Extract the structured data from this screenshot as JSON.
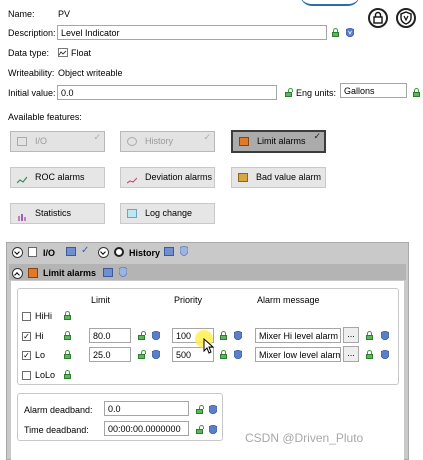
{
  "header": {
    "name_label": "Name:",
    "name_value": "PV",
    "description_label": "Description:",
    "description_value": "Level Indicator",
    "datatype_label": "Data type:",
    "datatype_value": "Float",
    "writeability_label": "Writeability:",
    "writeability_value": "Object writeable",
    "initial_value_label": "Initial value:",
    "initial_value": "0.0",
    "eng_units_label": "Eng units:",
    "eng_units_value": "Gallons",
    "available_features_label": "Available features:"
  },
  "features": {
    "io": "I/O",
    "history": "History",
    "limit_alarms": "Limit alarms",
    "roc_alarms": "ROC alarms",
    "deviation_alarms": "Deviation alarms",
    "bad_value_alarm": "Bad value alarm",
    "statistics": "Statistics",
    "log_change": "Log change"
  },
  "sections": {
    "io": "I/O",
    "history": "History",
    "limit_alarms": "Limit alarms"
  },
  "limits": {
    "col_limit": "Limit",
    "col_priority": "Priority",
    "col_alarm_message": "Alarm message",
    "rows": [
      {
        "name": "HiHi",
        "checked": false,
        "limit": "",
        "priority": "",
        "message": ""
      },
      {
        "name": "Hi",
        "checked": true,
        "limit": "80.0",
        "priority": "100",
        "message": "Mixer Hi level alarm"
      },
      {
        "name": "Lo",
        "checked": true,
        "limit": "25.0",
        "priority": "500",
        "message": "Mixer low level alarm"
      },
      {
        "name": "LoLo",
        "checked": false,
        "limit": "",
        "priority": "",
        "message": ""
      }
    ],
    "browse_label": "...",
    "alarm_deadband_label": "Alarm deadband:",
    "alarm_deadband_value": "0.0",
    "time_deadband_label": "Time deadband:",
    "time_deadband_value": "00:00:00.0000000"
  },
  "watermark": "CSDN @Driven_Pluto"
}
